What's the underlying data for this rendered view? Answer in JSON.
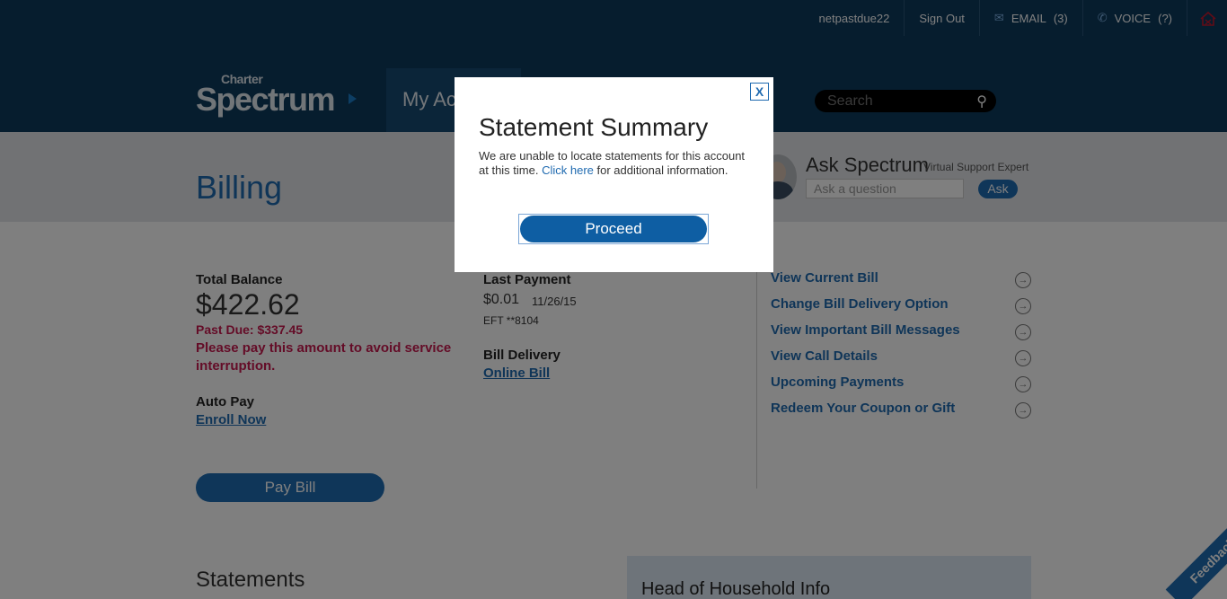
{
  "topbar": {
    "username": "netpastdue22",
    "sign_out": "Sign Out",
    "email_label": "EMAIL",
    "email_count": "(3)",
    "voice_label": "VOICE",
    "voice_count": "(?)"
  },
  "logo": {
    "charter": "Charter",
    "spectrum": "Spectrum"
  },
  "nav": {
    "my_account": "My Ac"
  },
  "search": {
    "placeholder": "Search"
  },
  "page": {
    "title": "Billing"
  },
  "ask": {
    "title": "Ask Spectrum",
    "subtitle": "Virtual Support Expert",
    "placeholder": "Ask a question",
    "button": "Ask"
  },
  "balance": {
    "label": "Total Balance",
    "amount": "$422.62",
    "past_due": "Past Due: $337.45",
    "warning_line1": "Please pay this amount to avoid service",
    "warning_line2": "interruption."
  },
  "autopay": {
    "label": "Auto Pay",
    "link": "Enroll Now"
  },
  "last_payment": {
    "label": "Last Payment",
    "amount": "$0.01",
    "date": "11/26/15",
    "method": "EFT **8104"
  },
  "bill_delivery": {
    "label": "Bill Delivery",
    "link": "Online Bill"
  },
  "pay_bill_button": "Pay Bill",
  "actions": [
    {
      "label": "View Current Bill"
    },
    {
      "label": "Change Bill Delivery Option"
    },
    {
      "label": "View Important Bill Messages"
    },
    {
      "label": "View Call Details"
    },
    {
      "label": "Upcoming Payments"
    },
    {
      "label": "Redeem Your Coupon or Gift"
    }
  ],
  "statements": {
    "title": "Statements"
  },
  "household": {
    "title": "Head of Household Info"
  },
  "feedback": "Feedback",
  "modal": {
    "close": "X",
    "title": "Statement Summary",
    "text_before": "We are unable to locate statements for this account at this time.",
    "link": "Click here",
    "text_after": "for additional information.",
    "proceed": "Proceed"
  }
}
